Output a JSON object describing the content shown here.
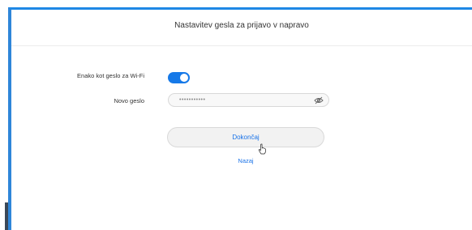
{
  "dialog": {
    "title": "Nastavitev gesla za prijavo v napravo"
  },
  "form": {
    "same_as_wifi_label": "Enako kot geslo za Wi-Fi",
    "same_as_wifi_enabled": true,
    "new_password_label": "Novo geslo",
    "new_password_value": "•••••••••••"
  },
  "actions": {
    "finish_label": "Dokončaj",
    "back_label": "Nazaj"
  },
  "colors": {
    "accent": "#1679e8",
    "frame_border": "#2f86d9"
  },
  "icons": {
    "password_visibility": "eye-slash-icon",
    "cursor": "hand-pointer-icon"
  }
}
